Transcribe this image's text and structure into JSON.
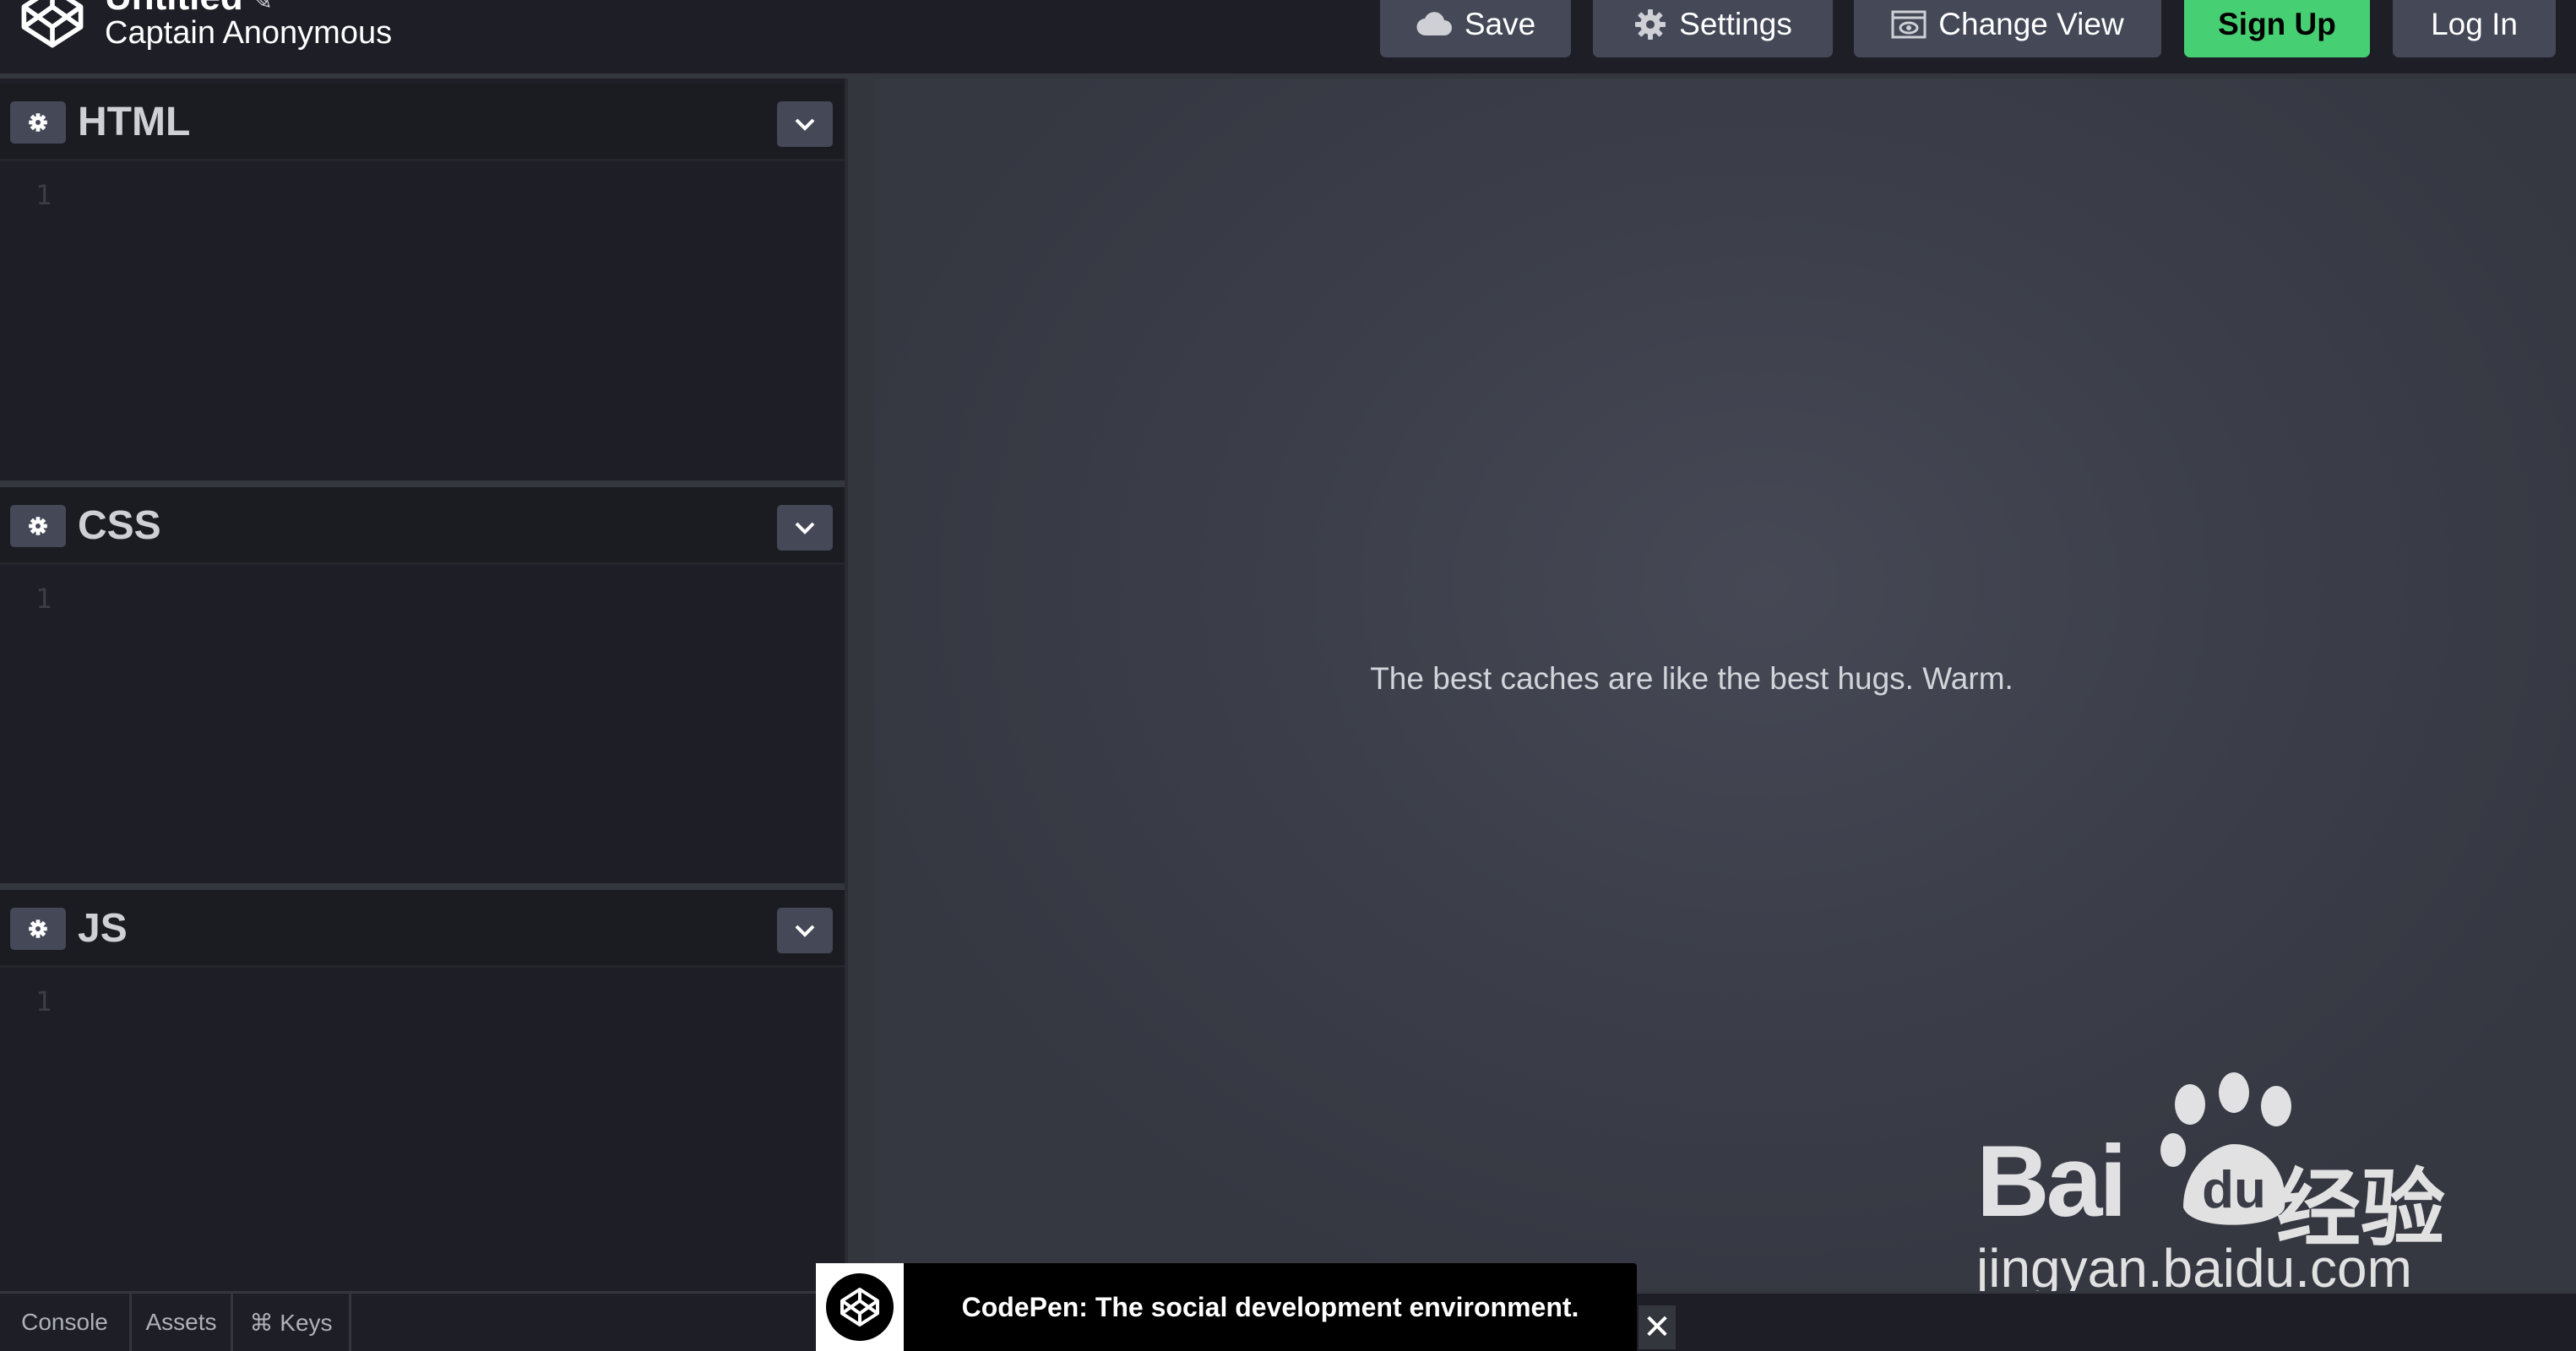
{
  "header": {
    "pen_title": "Untitled",
    "pen_owner": "Captain Anonymous",
    "buttons": {
      "save": "Save",
      "settings": "Settings",
      "change_view": "Change View",
      "sign_up": "Sign Up",
      "log_in": "Log In"
    }
  },
  "editors": [
    {
      "name": "HTML",
      "line": "1"
    },
    {
      "name": "CSS",
      "line": "1"
    },
    {
      "name": "JS",
      "line": "1"
    }
  ],
  "preview": {
    "text": "The best caches are like the best hugs. Warm."
  },
  "footer": {
    "tabs": [
      "Console",
      "Assets",
      "⌘ Keys"
    ]
  },
  "toast": {
    "text": "CodePen: The social development environment.",
    "close": "✕"
  },
  "watermark": {
    "brand_left": "Bai",
    "brand_du": "du",
    "brand_cn": "经验",
    "url": "jingyan.baidu.com"
  },
  "colors": {
    "background": "#1e1f26",
    "button": "#444857",
    "signup": "#47cf73",
    "preview": "#3c3f4a"
  },
  "icons": {
    "logo": "codepen-logo-icon",
    "save": "cloud-icon",
    "settings": "gear-icon",
    "change_view": "view-layout-icon",
    "editor_settings": "gear-icon",
    "editor_collapse": "chevron-down-icon",
    "close": "close-icon"
  }
}
